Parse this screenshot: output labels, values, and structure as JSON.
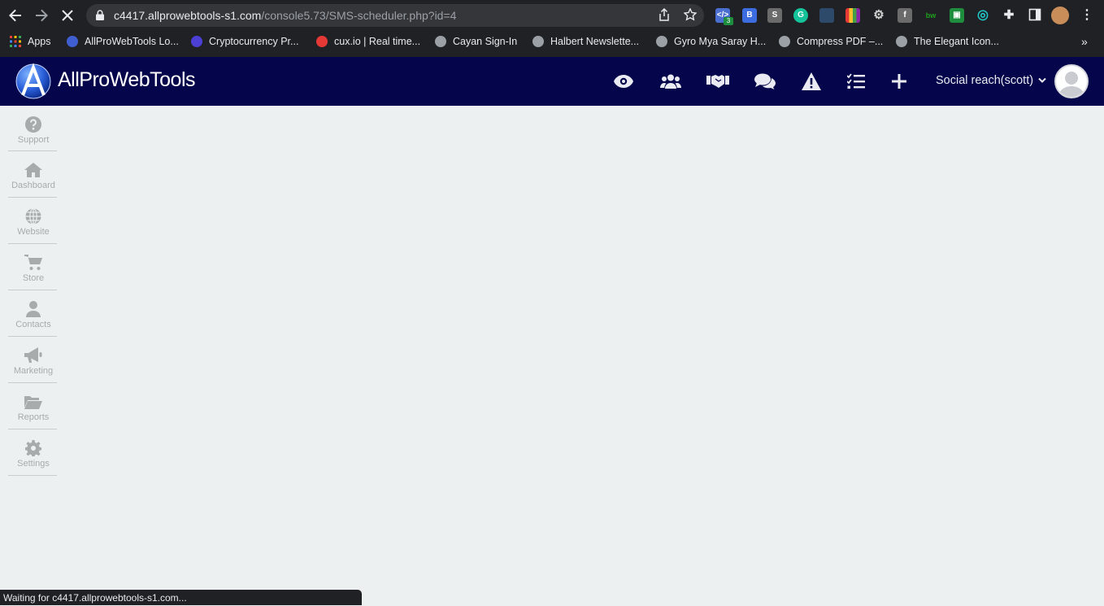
{
  "browser": {
    "url_host": "c4417.allprowebtools-s1.com",
    "url_path": "/console5.73/SMS-scheduler.php?id=4",
    "extension_badge": "3",
    "bookmarks": [
      {
        "label": "Apps",
        "icon": "apps-grid-icon"
      },
      {
        "label": "AllProWebTools Lo...",
        "icon": "allprowebtools-icon"
      },
      {
        "label": "Cryptocurrency Pr...",
        "icon": "crypto-icon"
      },
      {
        "label": "cux.io | Real time...",
        "icon": "cux-icon"
      },
      {
        "label": "Cayan Sign-In",
        "icon": "globe-icon"
      },
      {
        "label": "Halbert Newslette...",
        "icon": "globe-icon"
      },
      {
        "label": "Gyro Mya Saray H...",
        "icon": "globe-icon"
      },
      {
        "label": "Compress PDF –...",
        "icon": "globe-icon"
      },
      {
        "label": "The Elegant Icon...",
        "icon": "globe-icon"
      }
    ],
    "overflow_label": "»",
    "status_text": "Waiting for c4417.allprowebtools-s1.com..."
  },
  "app": {
    "brand": "AllProWebTools",
    "account_label": "Social reach(scott)",
    "header_icons": [
      "eye-icon",
      "users-icon",
      "handshake-icon",
      "comments-icon",
      "warning-icon",
      "tasks-icon",
      "plus-icon"
    ],
    "sidebar": [
      {
        "label": "Support",
        "icon": "question-circle-icon"
      },
      {
        "label": "Dashboard",
        "icon": "home-icon"
      },
      {
        "label": "Website",
        "icon": "globe-icon"
      },
      {
        "label": "Store",
        "icon": "cart-icon"
      },
      {
        "label": "Contacts",
        "icon": "user-icon"
      },
      {
        "label": "Marketing",
        "icon": "megaphone-icon"
      },
      {
        "label": "Reports",
        "icon": "folder-open-icon"
      },
      {
        "label": "Settings",
        "icon": "gear-icon"
      }
    ]
  },
  "colors": {
    "header_bg": "#04054a",
    "page_bg": "#ecf0f0",
    "sidebar_text": "#a7abab",
    "chrome_bg": "#202124"
  }
}
